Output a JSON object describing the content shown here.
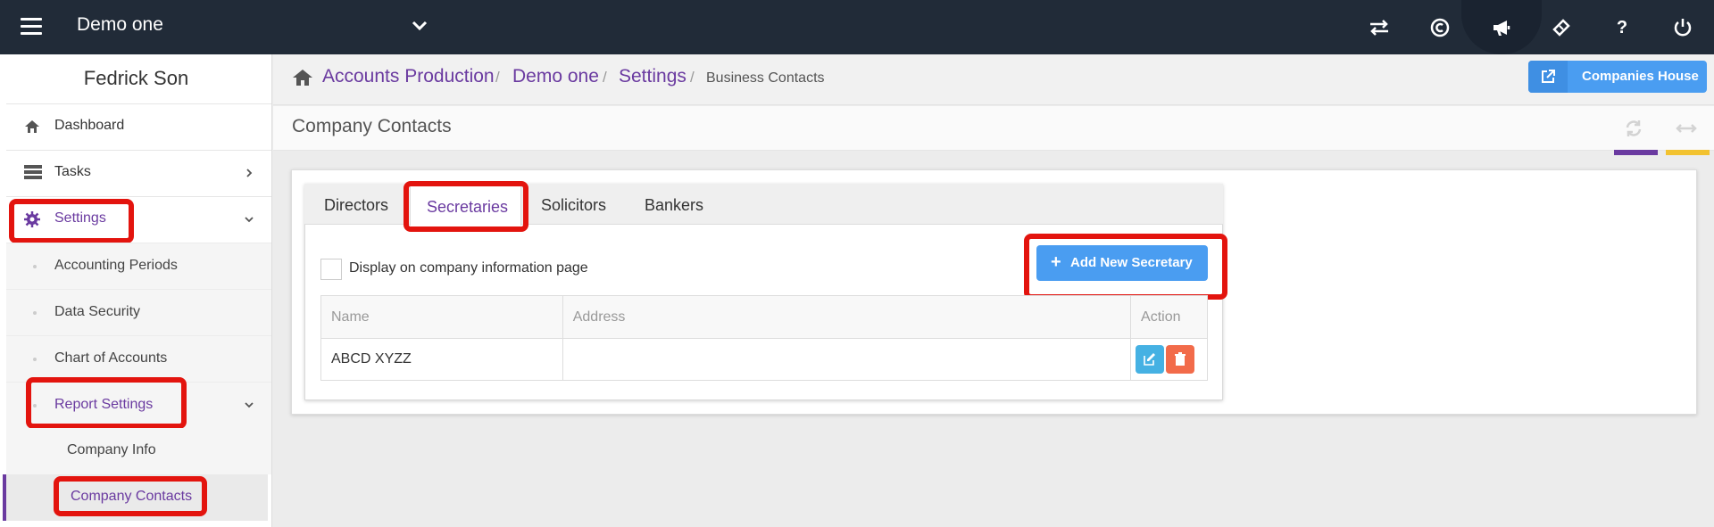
{
  "topbar": {
    "company": "Demo one",
    "icons": [
      "hamburger-icon",
      "chevron-down-icon",
      "transfer-icon",
      "copyright-icon",
      "megaphone-icon",
      "ticket-icon",
      "help-icon",
      "power-icon"
    ],
    "bg": "#212b38"
  },
  "sidebar": {
    "user": "Fedrick Son",
    "items": [
      {
        "label": "Dashboard",
        "icon": "home-icon"
      },
      {
        "label": "Tasks",
        "icon": "tasks-icon"
      },
      {
        "label": "Settings",
        "icon": "gear-icon"
      }
    ],
    "settings_sub": [
      "Accounting Periods",
      "Data Security",
      "Chart of Accounts",
      "Report Settings"
    ],
    "report_sub": [
      "Company Info",
      "Company Contacts"
    ]
  },
  "breadcrumb": {
    "items": [
      "Accounts Production",
      "Demo one",
      "Settings"
    ],
    "current": "Business Contacts"
  },
  "companies_house_label": "Companies House",
  "page_title": "Company Contacts",
  "tabs": [
    "Directors",
    "Secretaries",
    "Solicitors",
    "Bankers"
  ],
  "active_tab": "Secretaries",
  "display_checkbox_label": "Display on company information page",
  "display_checkbox_checked": false,
  "add_button_label": "Add New Secretary",
  "table": {
    "headers": [
      "Name",
      "Address",
      "Action"
    ],
    "rows": [
      {
        "name": "ABCD XYZZ",
        "address": ""
      }
    ]
  },
  "colors": {
    "accent": "#6a3aa0",
    "button_blue": "#4a9df1",
    "edit": "#45b1e3",
    "delete": "#f26b4a",
    "highlight": "#e3140e",
    "yellow": "#f2c230"
  }
}
